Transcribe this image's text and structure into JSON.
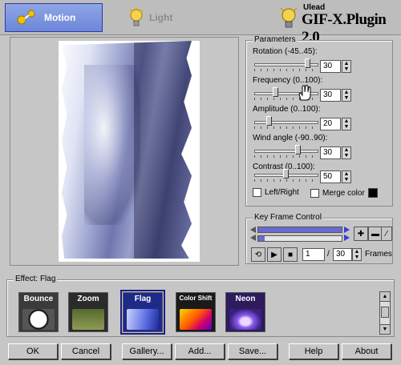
{
  "header": {
    "tabs": [
      {
        "label": "Motion",
        "icon": "motion-icon",
        "active": true
      },
      {
        "label": "Light",
        "icon": "lightbulb-icon",
        "active": false
      }
    ],
    "brand_small": "Ulead",
    "brand_name": "GIF-X.Plugin 2.0"
  },
  "parameters": {
    "title": "Parameters",
    "fields": [
      {
        "label": "Rotation (-45..45):",
        "value": "30",
        "level": 0.83
      },
      {
        "label": "Frequency (0..100):",
        "value": "30",
        "level": 0.3
      },
      {
        "label": "Amplitude (0..100):",
        "value": "20",
        "level": 0.2
      },
      {
        "label": "Wind angle (-90..90):",
        "value": "30",
        "level": 0.67
      },
      {
        "label": "Contrast (0..100):",
        "value": "50",
        "level": 0.5
      }
    ],
    "left_right_label": "Left/Right",
    "merge_color_label": "Merge color",
    "merge_color": "#000000"
  },
  "keyframe": {
    "title": "Key Frame Control",
    "current_frame": "1",
    "total_frames": "30",
    "frames_label": "Frames",
    "separator": "/"
  },
  "effects": {
    "title": "Effect: Flag",
    "items": [
      {
        "label": "Bounce",
        "icon": "bounce-icon"
      },
      {
        "label": "Zoom",
        "icon": "zoom-icon"
      },
      {
        "label": "Flag",
        "icon": "flag-icon",
        "selected": true
      },
      {
        "label": "Color Shift",
        "icon": "color-shift-icon"
      },
      {
        "label": "Neon",
        "icon": "neon-icon"
      }
    ]
  },
  "buttons": {
    "ok": "OK",
    "cancel": "Cancel",
    "gallery": "Gallery...",
    "add": "Add...",
    "save": "Save...",
    "help": "Help",
    "about": "About"
  }
}
